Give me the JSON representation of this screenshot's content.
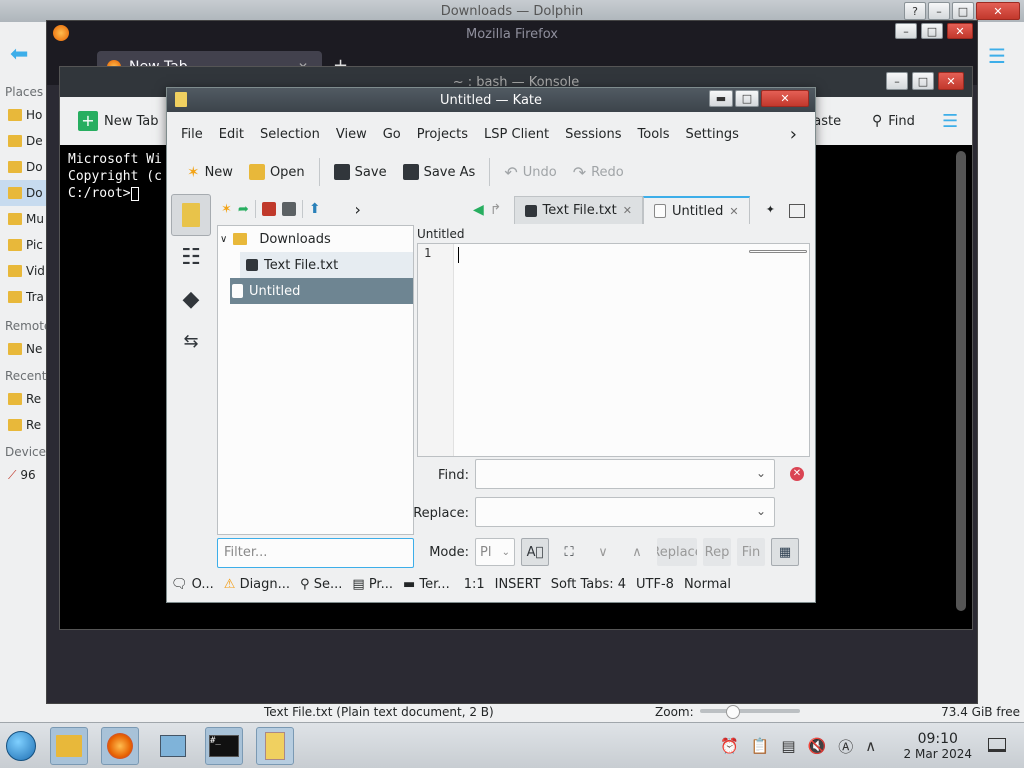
{
  "dolphin": {
    "title": "Downloads — Dolphin",
    "places_header": "Places",
    "places": [
      "Ho",
      "De",
      "Do",
      "Do",
      "Mu",
      "Pic",
      "Vid",
      "Tra"
    ],
    "remote_header": "Remote",
    "remote": [
      "Ne"
    ],
    "recent_header": "Recent",
    "recent": [
      "Re",
      "Re"
    ],
    "devices_header": "Device",
    "devices": [
      "96"
    ],
    "paste_label": "Paste",
    "find_label": "Find",
    "status_text": "Text File.txt (Plain text document, 2 B)",
    "zoom_label": "Zoom:",
    "free_space": "73.4 GiB free"
  },
  "firefox": {
    "title": "Mozilla Firefox",
    "tab_label": "New Tab",
    "close_glyph": "✕",
    "new_tab_glyph": "+"
  },
  "konsole": {
    "title": "~ : bash — Konsole",
    "new_tab_label": "New Tab",
    "lines": [
      "Microsoft Wi",
      "Copyright (c",
      "",
      "C:/root>"
    ]
  },
  "kate": {
    "title": "Untitled — Kate",
    "menu": [
      "File",
      "Edit",
      "Selection",
      "View",
      "Go",
      "Projects",
      "LSP Client",
      "Sessions",
      "Tools",
      "Settings"
    ],
    "more_glyph": "›",
    "toolbar": {
      "new": "New",
      "open": "Open",
      "save": "Save",
      "save_as": "Save As",
      "undo": "Undo",
      "redo": "Redo"
    },
    "tabs": [
      {
        "label": "Text File.txt",
        "close": "✕"
      },
      {
        "label": "Untitled",
        "close": "✕"
      }
    ],
    "tree": {
      "folder": "Downloads",
      "files": [
        "Text File.txt",
        "Untitled"
      ]
    },
    "filter_placeholder": "Filter...",
    "doc_label": "Untitled",
    "line_number": "1",
    "find_label": "Find:",
    "replace_label": "Replace:",
    "mode_label": "Mode:",
    "mode_value": "Pl",
    "replace_btn": "Replace",
    "replace_all_btn": "Rep",
    "find_all_btn": "Fin",
    "status": {
      "output": "O...",
      "diagnostics": "Diagn...",
      "search": "Se...",
      "projects": "Pr...",
      "terminal": "Ter...",
      "cursor": "1:1",
      "mode": "INSERT",
      "indent": "Soft Tabs: 4",
      "encoding": "UTF-8",
      "highlight": "Normal"
    }
  },
  "taskbar": {
    "time": "09:10",
    "date": "2 Mar 2024"
  }
}
